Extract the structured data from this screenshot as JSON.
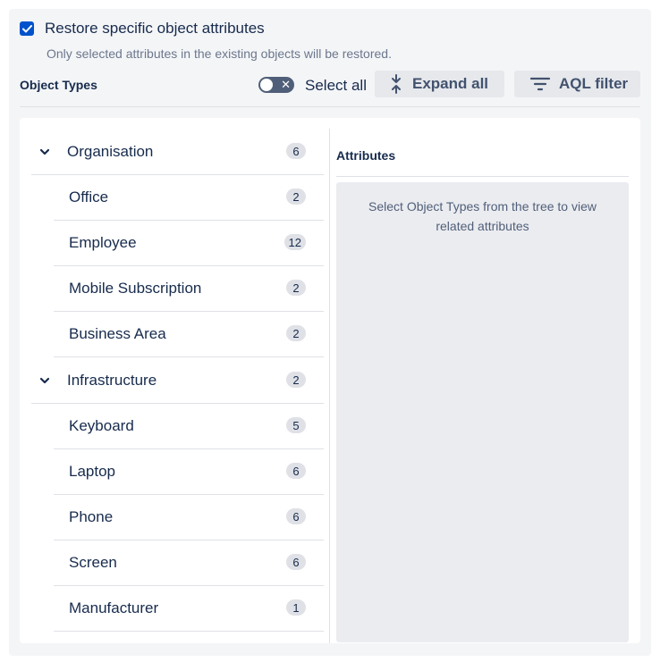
{
  "restore": {
    "label": "Restore specific object attributes",
    "sublabel": "Only selected attributes in the existing objects will be restored.",
    "checked": true
  },
  "header": {
    "title": "Object Types",
    "select_all_label": "Select all",
    "expand_all_label": "Expand all",
    "aql_filter_label": "AQL filter"
  },
  "tree": {
    "groups": [
      {
        "label": "Organisation",
        "count": "6"
      },
      {
        "label": "Infrastructure",
        "count": "2"
      }
    ],
    "organisation_children": [
      {
        "label": "Office",
        "count": "2"
      },
      {
        "label": "Employee",
        "count": "12"
      },
      {
        "label": "Mobile Subscription",
        "count": "2"
      },
      {
        "label": "Business Area",
        "count": "2"
      }
    ],
    "infrastructure_children": [
      {
        "label": "Keyboard",
        "count": "5"
      },
      {
        "label": "Laptop",
        "count": "6"
      },
      {
        "label": "Phone",
        "count": "6"
      },
      {
        "label": "Screen",
        "count": "6"
      },
      {
        "label": "Manufacturer",
        "count": "1"
      }
    ]
  },
  "attributes": {
    "title": "Attributes",
    "empty_message": "Select Object Types from the tree to view related attributes"
  },
  "colors": {
    "accent": "#0052cc",
    "toggle_off": "#505f79",
    "panel_bg": "#f4f5f7",
    "badge_bg": "#dfe1e6"
  }
}
